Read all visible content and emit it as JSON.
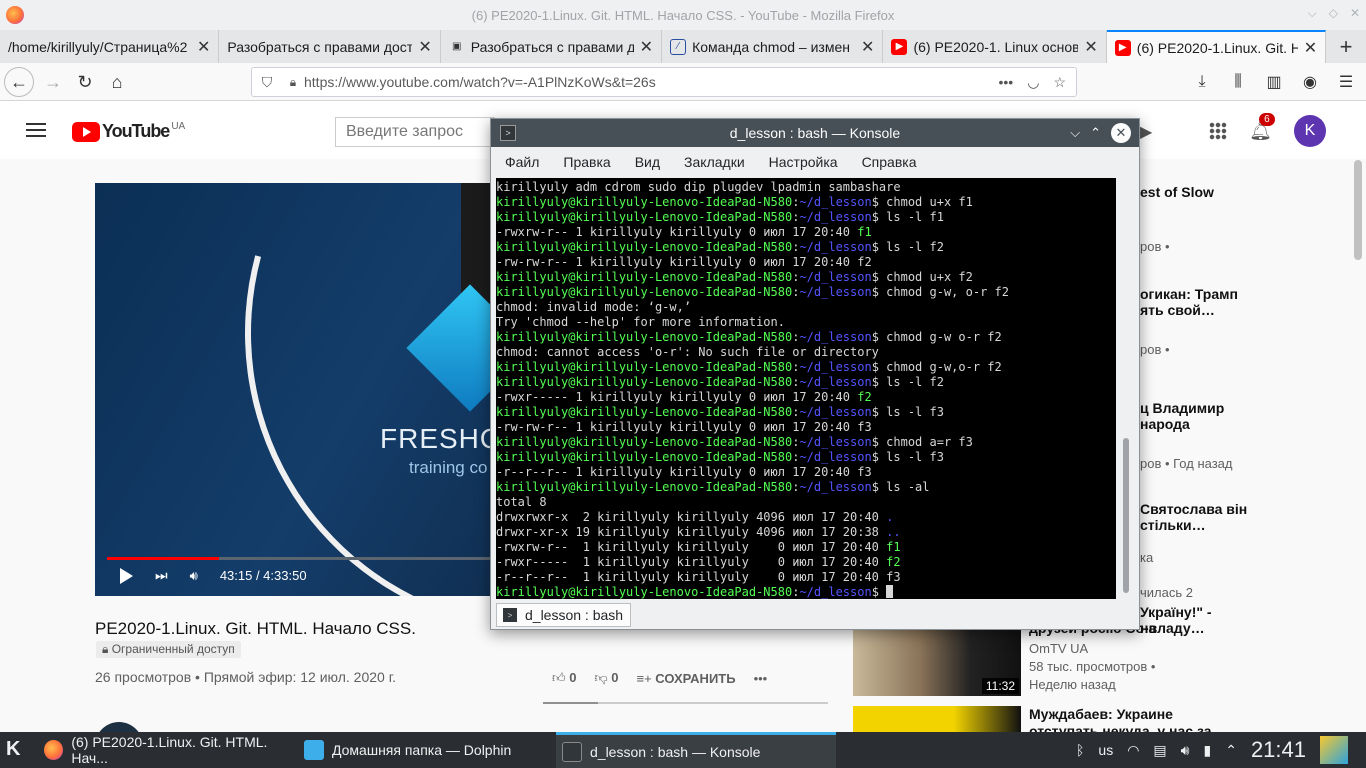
{
  "window": {
    "title": "(6) PE2020-1.Linux. Git. HTML. Начало CSS. - YouTube - Mozilla Firefox",
    "controls": [
      "⌵",
      "◇",
      "✕"
    ]
  },
  "tabs": [
    {
      "label": "/home/kirillyuly/Страница%2",
      "fav": "",
      "fav_color": "#ffffff"
    },
    {
      "label": "Разобраться с правами дост",
      "fav": "",
      "fav_color": "#ffffff"
    },
    {
      "label": "Разобраться с правами д",
      "fav": "▣",
      "fav_color": "#333333"
    },
    {
      "label": "Команда chmod – измен",
      "fav": "⁄",
      "fav_color": "#2b4fa0"
    },
    {
      "label": "(6) PE2020-1. Linux основ",
      "fav": "▶",
      "fav_color": "#ff0000"
    },
    {
      "label": "(6) PE2020-1.Linux. Git. HT",
      "fav": "▶",
      "fav_color": "#ff0000"
    }
  ],
  "nav": {
    "url": "https://www.youtube.com/watch?v=-A1PlNzKoWs&t=26s"
  },
  "youtube": {
    "region": "UA",
    "logo_text": "YouTube",
    "search_placeholder": "Введите запрос",
    "notif_count": "6",
    "avatar_letter": "K",
    "video": {
      "overlay_brand": "FRESHO",
      "overlay_sub": "training co",
      "time": "43:15 / 4:33:50",
      "progress": 0.158,
      "title": "PE2020-1.Linux. Git. HTML. Начало CSS.",
      "restricted": "Ограниченный доступ",
      "meta": "26 просмотров • Прямой эфир: 12 июл. 2020 г.",
      "likes": "0",
      "dislikes": "0",
      "save": "СОХРАНИТЬ"
    },
    "sidebar": [
      {
        "title": "est of Slow",
        "meta": "ров •"
      },
      {
        "title": "огикан: Трамп ять свой…",
        "meta": "ров •"
      },
      {
        "title": "ц Владимир народа",
        "meta": "ров • Год назад"
      },
      {
        "title": "Святослава він стільки…",
        "meta": "ка\nчилась 2"
      },
      {
        "title": "Україну!\" - на",
        "meta": ""
      },
      {
        "title": "",
        "meta": "OmTV UA\n58 тыс. просмотров •\nНеделю назад",
        "duration": "11:32"
      },
      {
        "title": "Муждабаев: Украине отступать некуда, у нас за",
        "meta": ""
      }
    ]
  },
  "konsole": {
    "title": "d_lesson : bash — Konsole",
    "menu": [
      "Файл",
      "Правка",
      "Вид",
      "Закладки",
      "Настройка",
      "Справка"
    ],
    "tab_label": "d_lesson : bash",
    "prompt_user": "kirillyuly@kirillyuly-Lenovo-IdeaPad-N580",
    "prompt_path": "~/d_lesson",
    "lines": [
      {
        "t": "out",
        "text": "kirillyuly adm cdrom sudo dip plugdev lpadmin sambashare"
      },
      {
        "t": "cmd",
        "text": "chmod u+x f1"
      },
      {
        "t": "cmd",
        "text": "ls -l f1"
      },
      {
        "t": "file",
        "text": "-rwxrw-r-- 1 kirillyuly kirillyuly 0 июл 17 20:40 ",
        "name": "f1"
      },
      {
        "t": "cmd",
        "text": "ls -l f2"
      },
      {
        "t": "out",
        "text": "-rw-rw-r-- 1 kirillyuly kirillyuly 0 июл 17 20:40 f2"
      },
      {
        "t": "cmd",
        "text": "chmod u+x f2"
      },
      {
        "t": "cmd",
        "text": "chmod g-w, o-r f2"
      },
      {
        "t": "out",
        "text": "chmod: invalid mode: ‘g-w,’"
      },
      {
        "t": "out",
        "text": "Try 'chmod --help' for more information."
      },
      {
        "t": "cmd",
        "text": "chmod g-w o-r f2"
      },
      {
        "t": "out",
        "text": "chmod: cannot access 'o-r': No such file or directory"
      },
      {
        "t": "cmd",
        "text": "chmod g-w,o-r f2"
      },
      {
        "t": "cmd",
        "text": "ls -l f2"
      },
      {
        "t": "file",
        "text": "-rwxr----- 1 kirillyuly kirillyuly 0 июл 17 20:40 ",
        "name": "f2"
      },
      {
        "t": "cmd",
        "text": "ls -l f3"
      },
      {
        "t": "out",
        "text": "-rw-rw-r-- 1 kirillyuly kirillyuly 0 июл 17 20:40 f3"
      },
      {
        "t": "cmd",
        "text": "chmod a=r f3"
      },
      {
        "t": "cmd",
        "text": "ls -l f3"
      },
      {
        "t": "out",
        "text": "-r--r--r-- 1 kirillyuly kirillyuly 0 июл 17 20:40 f3"
      },
      {
        "t": "cmd",
        "text": "ls -al"
      },
      {
        "t": "out",
        "text": "total 8"
      },
      {
        "t": "dir",
        "text": "drwxrwxr-x  2 kirillyuly kirillyuly 4096 июл 17 20:40 ",
        "name": "."
      },
      {
        "t": "dir",
        "text": "drwxr-xr-x 19 kirillyuly kirillyuly 4096 июл 17 20:38 ",
        "name": ".."
      },
      {
        "t": "file",
        "text": "-rwxrw-r--  1 kirillyuly kirillyuly    0 июл 17 20:40 ",
        "name": "f1"
      },
      {
        "t": "file",
        "text": "-rwxr-----  1 kirillyuly kirillyuly    0 июл 17 20:40 ",
        "name": "f2"
      },
      {
        "t": "out",
        "text": "-r--r--r--  1 kirillyuly kirillyuly    0 июл 17 20:40 f3"
      },
      {
        "t": "prompt",
        "text": ""
      }
    ]
  },
  "taskbar": {
    "items": [
      {
        "label": "(6) PE2020-1.Linux. Git. HTML. Нач...",
        "color": "#ff7139"
      },
      {
        "label": "Домашняя папка — Dolphin",
        "color": "#3daee9"
      },
      {
        "label": "d_lesson : bash — Konsole",
        "color": "#31363b"
      }
    ],
    "layout": "us",
    "clock": "21:41"
  }
}
